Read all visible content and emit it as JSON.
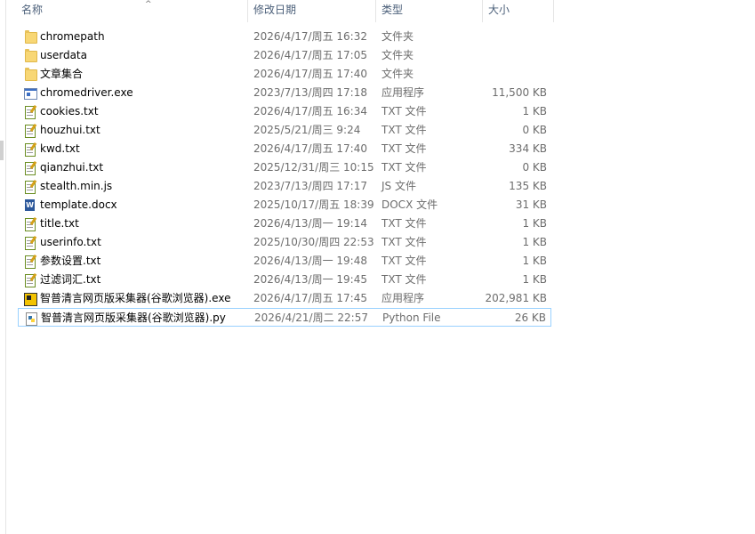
{
  "columns": {
    "name": "名称",
    "date": "修改日期",
    "type": "类型",
    "size": "大小"
  },
  "files": [
    {
      "name": "chromepath",
      "date": "2026/4/17/周五 16:32",
      "type": "文件夹",
      "size": "",
      "icon": "folder-icon"
    },
    {
      "name": "userdata",
      "date": "2026/4/17/周五 17:05",
      "type": "文件夹",
      "size": "",
      "icon": "folder-icon"
    },
    {
      "name": "文章集合",
      "date": "2026/4/17/周五 17:40",
      "type": "文件夹",
      "size": "",
      "icon": "folder-icon"
    },
    {
      "name": "chromedriver.exe",
      "date": "2023/7/13/周四 17:18",
      "type": "应用程序",
      "size": "11,500 KB",
      "icon": "exe-icon"
    },
    {
      "name": "cookies.txt",
      "date": "2026/4/17/周五 16:34",
      "type": "TXT 文件",
      "size": "1 KB",
      "icon": "text-file-icon"
    },
    {
      "name": "houzhui.txt",
      "date": "2025/5/21/周三 9:24",
      "type": "TXT 文件",
      "size": "0 KB",
      "icon": "text-file-icon"
    },
    {
      "name": "kwd.txt",
      "date": "2026/4/17/周五 17:40",
      "type": "TXT 文件",
      "size": "334 KB",
      "icon": "text-file-icon"
    },
    {
      "name": "qianzhui.txt",
      "date": "2025/12/31/周三 10:15",
      "type": "TXT 文件",
      "size": "0 KB",
      "icon": "text-file-icon"
    },
    {
      "name": "stealth.min.js",
      "date": "2023/7/13/周四 17:17",
      "type": "JS 文件",
      "size": "135 KB",
      "icon": "script-file-icon"
    },
    {
      "name": "template.docx",
      "date": "2025/10/17/周五 18:39",
      "type": "DOCX 文件",
      "size": "31 KB",
      "icon": "word-document-icon"
    },
    {
      "name": "title.txt",
      "date": "2026/4/13/周一 19:14",
      "type": "TXT 文件",
      "size": "1 KB",
      "icon": "text-file-icon"
    },
    {
      "name": "userinfo.txt",
      "date": "2025/10/30/周四 22:53",
      "type": "TXT 文件",
      "size": "1 KB",
      "icon": "text-file-icon"
    },
    {
      "name": "参数设置.txt",
      "date": "2026/4/13/周一 19:48",
      "type": "TXT 文件",
      "size": "1 KB",
      "icon": "text-file-icon"
    },
    {
      "name": "过滤词汇.txt",
      "date": "2026/4/13/周一 19:45",
      "type": "TXT 文件",
      "size": "1 KB",
      "icon": "text-file-icon"
    },
    {
      "name": "智普清言网页版采集器(谷歌浏览器).exe",
      "date": "2026/4/17/周五 17:45",
      "type": "应用程序",
      "size": "202,981 KB",
      "icon": "app-icon"
    },
    {
      "name": "智普清言网页版采集器(谷歌浏览器).py",
      "date": "2026/4/21/周二 22:57",
      "type": "Python File",
      "size": "26 KB",
      "icon": "python-file-icon",
      "selected": true
    }
  ]
}
